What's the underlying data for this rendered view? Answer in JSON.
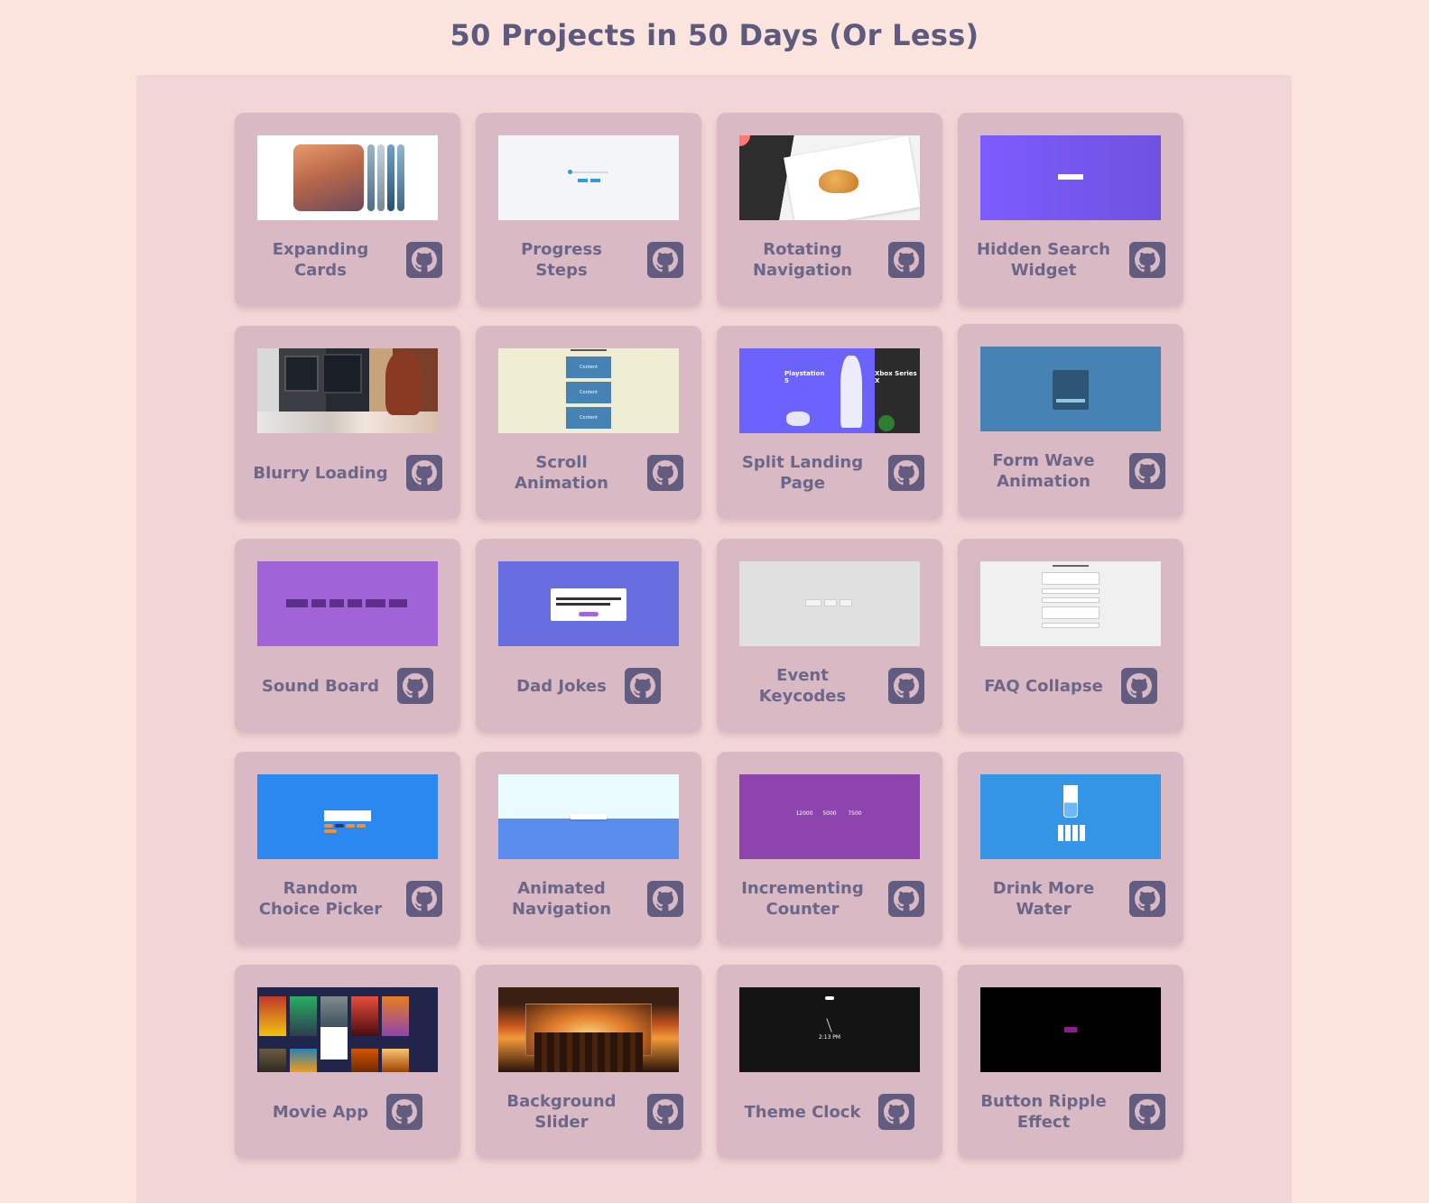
{
  "page": {
    "title": "50 Projects in 50 Days (Or Less)"
  },
  "colors": {
    "background": "#fbe4dd",
    "panel": "#f2d5d6",
    "card": "#d8b9c4",
    "icon_bg": "#625d80",
    "text": "#6c6788"
  },
  "projects": [
    {
      "title": "Expanding Cards",
      "icon": "github-icon"
    },
    {
      "title": "Progress Steps",
      "icon": "github-icon"
    },
    {
      "title": "Rotating Navigation",
      "icon": "github-icon"
    },
    {
      "title": "Hidden Search Widget",
      "icon": "github-icon"
    },
    {
      "title": "Blurry Loading",
      "icon": "github-icon"
    },
    {
      "title": "Scroll Animation",
      "icon": "github-icon"
    },
    {
      "title": "Split Landing Page",
      "icon": "github-icon"
    },
    {
      "title": "Form Wave Animation",
      "icon": "github-icon"
    },
    {
      "title": "Sound Board",
      "icon": "github-icon"
    },
    {
      "title": "Dad Jokes",
      "icon": "github-icon"
    },
    {
      "title": "Event Keycodes",
      "icon": "github-icon"
    },
    {
      "title": "FAQ Collapse",
      "icon": "github-icon"
    },
    {
      "title": "Random Choice Picker",
      "icon": "github-icon"
    },
    {
      "title": "Animated Navigation",
      "icon": "github-icon"
    },
    {
      "title": "Incrementing Counter",
      "icon": "github-icon"
    },
    {
      "title": "Drink More Water",
      "icon": "github-icon"
    },
    {
      "title": "Movie App",
      "icon": "github-icon"
    },
    {
      "title": "Background Slider",
      "icon": "github-icon"
    },
    {
      "title": "Theme Clock",
      "icon": "github-icon"
    },
    {
      "title": "Button Ripple Effect",
      "icon": "github-icon"
    }
  ],
  "thumbnails": {
    "scroll_animation": {
      "item_label": "Content"
    },
    "split_landing": {
      "left": "Playstation 5",
      "right": "Xbox Series X"
    },
    "incrementing_counter": {
      "values": [
        "12000",
        "5000",
        "7500"
      ]
    },
    "theme_clock": {
      "time": "2:13 PM"
    }
  }
}
